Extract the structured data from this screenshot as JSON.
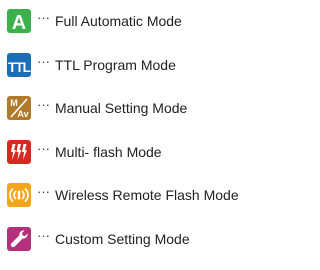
{
  "legend": {
    "items": [
      {
        "icon": "auto-mode-icon",
        "icon_text": "A",
        "color": "#3cb04a",
        "dots": "···",
        "label": "Full Automatic Mode"
      },
      {
        "icon": "ttl-mode-icon",
        "icon_text": "TTL",
        "color": "#1a6fb8",
        "dots": "···",
        "label": "TTL Program Mode"
      },
      {
        "icon": "manual-mode-icon",
        "icon_text_top": "M",
        "icon_text_bottom": "Av",
        "color": "#b07a2a",
        "dots": "···",
        "label": "Manual Setting Mode"
      },
      {
        "icon": "multi-flash-icon",
        "color": "#d62a20",
        "dots": "···",
        "label": "Multi- flash Mode"
      },
      {
        "icon": "wireless-remote-icon",
        "color": "#f5a51c",
        "dots": "···",
        "label": "Wireless Remote Flash Mode"
      },
      {
        "icon": "custom-setting-icon",
        "color": "#b5307a",
        "dots": "···",
        "label": "Custom Setting Mode"
      }
    ]
  }
}
